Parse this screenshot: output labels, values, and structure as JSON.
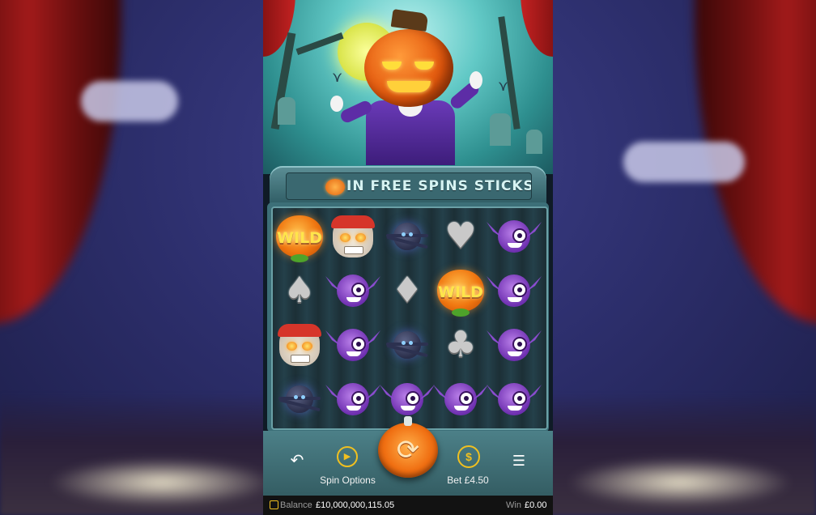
{
  "banner": {
    "text": "IN FREE SPINS STICKS A"
  },
  "grid": [
    [
      "wild",
      "skull",
      "spider",
      "heart",
      "bat"
    ],
    [
      "spade",
      "bat",
      "diamond",
      "wild",
      "bat"
    ],
    [
      "skull",
      "bat",
      "spider",
      "club",
      "bat"
    ],
    [
      "spider",
      "bat",
      "bat",
      "bat",
      "bat"
    ]
  ],
  "symbols": {
    "wild_label": "WILD",
    "heart": "♥",
    "spade": "♠",
    "diamond": "♦",
    "club": "♣"
  },
  "controls": {
    "back_icon": "↶",
    "spin_options_label": "Spin Options",
    "spin_icon": "⟳",
    "bet_label": "Bet",
    "bet_value": "£4.50",
    "coin_icon": "$",
    "play_icon": "▶",
    "menu_icon": "☰"
  },
  "status": {
    "balance_label": "Balance",
    "balance_value": "£10,000,000,115.05",
    "win_label": "Win",
    "win_value": "£0.00"
  },
  "colors": {
    "accent_orange": "#f06f12",
    "panel_teal": "#4c8088",
    "gold": "#f0c020"
  }
}
